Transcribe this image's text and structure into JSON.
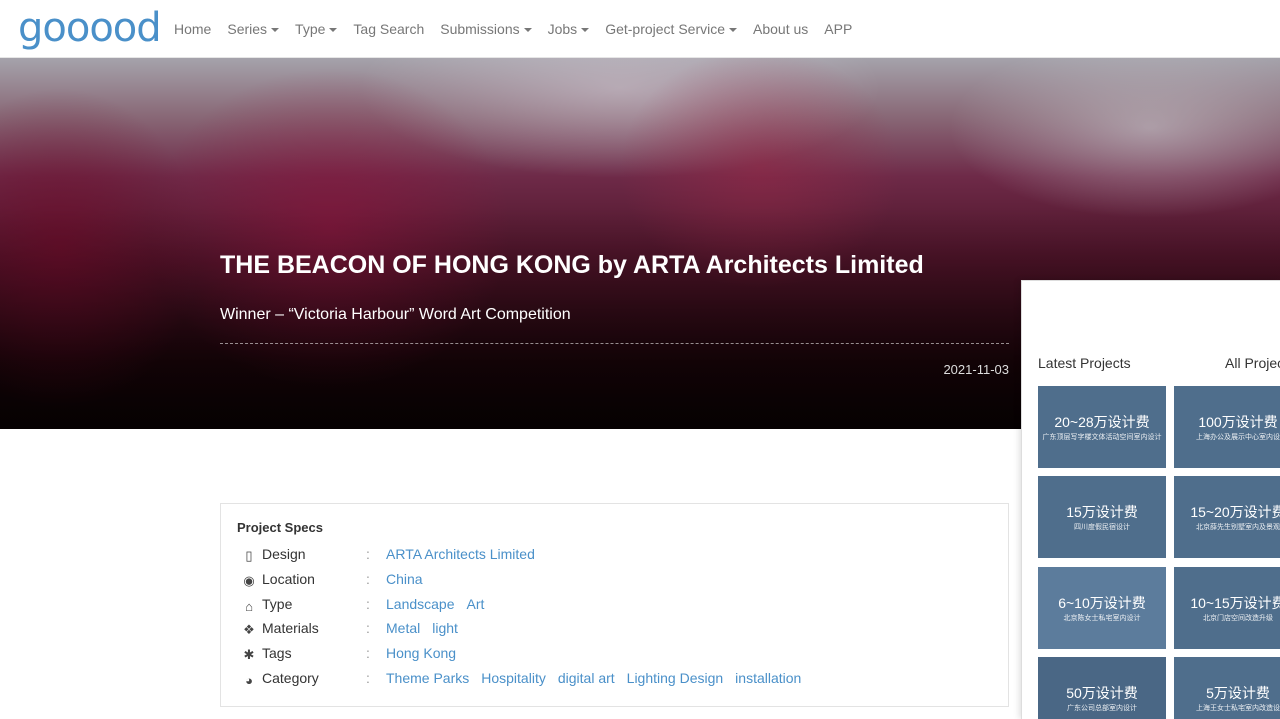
{
  "nav": {
    "logo": "gooood",
    "items": [
      {
        "label": "Home",
        "dropdown": false
      },
      {
        "label": "Series",
        "dropdown": true
      },
      {
        "label": "Type",
        "dropdown": true
      },
      {
        "label": "Tag Search",
        "dropdown": false
      },
      {
        "label": "Submissions",
        "dropdown": true
      },
      {
        "label": "Jobs",
        "dropdown": true
      },
      {
        "label": "Get-project Service",
        "dropdown": true
      },
      {
        "label": "About us",
        "dropdown": false
      },
      {
        "label": "APP",
        "dropdown": false
      }
    ]
  },
  "hero": {
    "title": "THE BEACON OF HONG KONG by ARTA Architects Limited",
    "subtitle": "Winner – “Victoria Harbour” Word Art Competition",
    "date": "2021-11-03"
  },
  "specs": {
    "title": "Project Specs",
    "rows": [
      {
        "icon": "building-icon",
        "glyph": "▯",
        "label": "Design",
        "values": [
          "ARTA Architects Limited"
        ]
      },
      {
        "icon": "globe-icon",
        "glyph": "◉",
        "label": "Location",
        "values": [
          "China"
        ]
      },
      {
        "icon": "bank-icon",
        "glyph": "⌂",
        "label": "Type",
        "values": [
          "Landscape",
          "Art"
        ]
      },
      {
        "icon": "cubes-icon",
        "glyph": "❖",
        "label": "Materials",
        "values": [
          "Metal",
          "light"
        ]
      },
      {
        "icon": "tags-icon",
        "glyph": "✱",
        "label": "Tags",
        "values": [
          "Hong Kong"
        ]
      },
      {
        "icon": "pie-chart-icon",
        "glyph": "◕",
        "label": "Category",
        "values": [
          "Theme Parks",
          "Hospitality",
          "digital art",
          "Lighting Design",
          "installation"
        ]
      }
    ]
  },
  "sidebar": {
    "latest_label": "Latest Projects",
    "all_label": "All Projec",
    "tiles": [
      {
        "main": "20~28万设计费",
        "sub": "广东顶层写字楼文体活动空间室内设计",
        "color": "#4f6e8c"
      },
      {
        "main": "100万设计费",
        "sub": "上海办公及展示中心室内设",
        "color": "#4f6e8c"
      },
      {
        "main": "15万设计费",
        "sub": "四川度假民宿设计",
        "color": "#4f6e8c"
      },
      {
        "main": "15~20万设计费",
        "sub": "北京薛先生别墅室内及景观",
        "color": "#4f6e8c"
      },
      {
        "main": "6~10万设计费",
        "sub": "北京陈女士私宅室内设计",
        "color": "#5c7c9c"
      },
      {
        "main": "10~15万设计费",
        "sub": "北京门店空间改造升级",
        "color": "#4f6e8c"
      },
      {
        "main": "50万设计费",
        "sub": "广东公司总部室内设计",
        "color": "#4a6785"
      },
      {
        "main": "5万设计费",
        "sub": "上海王女士私宅室内改造设",
        "color": "#4f6e8c"
      }
    ]
  }
}
